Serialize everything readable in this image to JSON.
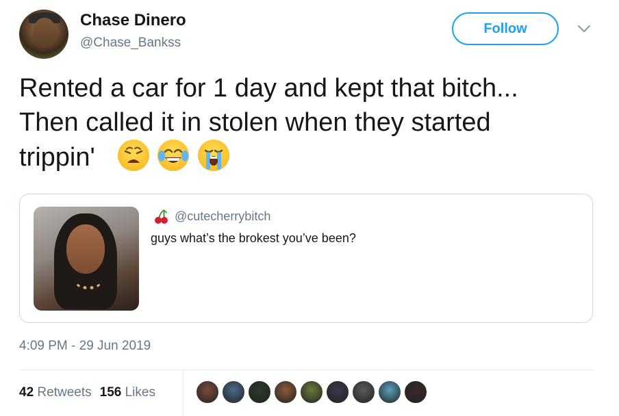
{
  "author": {
    "name": "Chase Dinero",
    "handle": "@Chase_Bankss"
  },
  "header": {
    "follow_label": "Follow"
  },
  "tweet": {
    "text_line1": "Rented a car for 1 day and kept that bitch...",
    "text_line2": "Then called it in stolen when they started",
    "text_line3": "trippin'",
    "emojis": [
      "weary-face-icon",
      "face-with-tears-of-joy-icon",
      "loudly-crying-face-icon"
    ]
  },
  "quoted": {
    "handle": "@cutecherrybitch",
    "name_icon": "cherries-icon",
    "text": "guys what’s the brokest you’ve been?"
  },
  "meta": {
    "timestamp": "4:09 PM - 29 Jun 2019"
  },
  "stats": {
    "retweets_count": "42",
    "retweets_label": "Retweets",
    "likes_count": "156",
    "likes_label": "Likes"
  },
  "likers": [
    {
      "color": "#7a4a3a"
    },
    {
      "color": "#4a6a8a"
    },
    {
      "color": "#2a3a2a"
    },
    {
      "color": "#8a5a3a"
    },
    {
      "color": "#6a7a3a"
    },
    {
      "color": "#3a3a4a"
    },
    {
      "color": "#5a5a5a"
    },
    {
      "color": "#5aa0b8"
    },
    {
      "color": "#3a2a2a"
    }
  ]
}
